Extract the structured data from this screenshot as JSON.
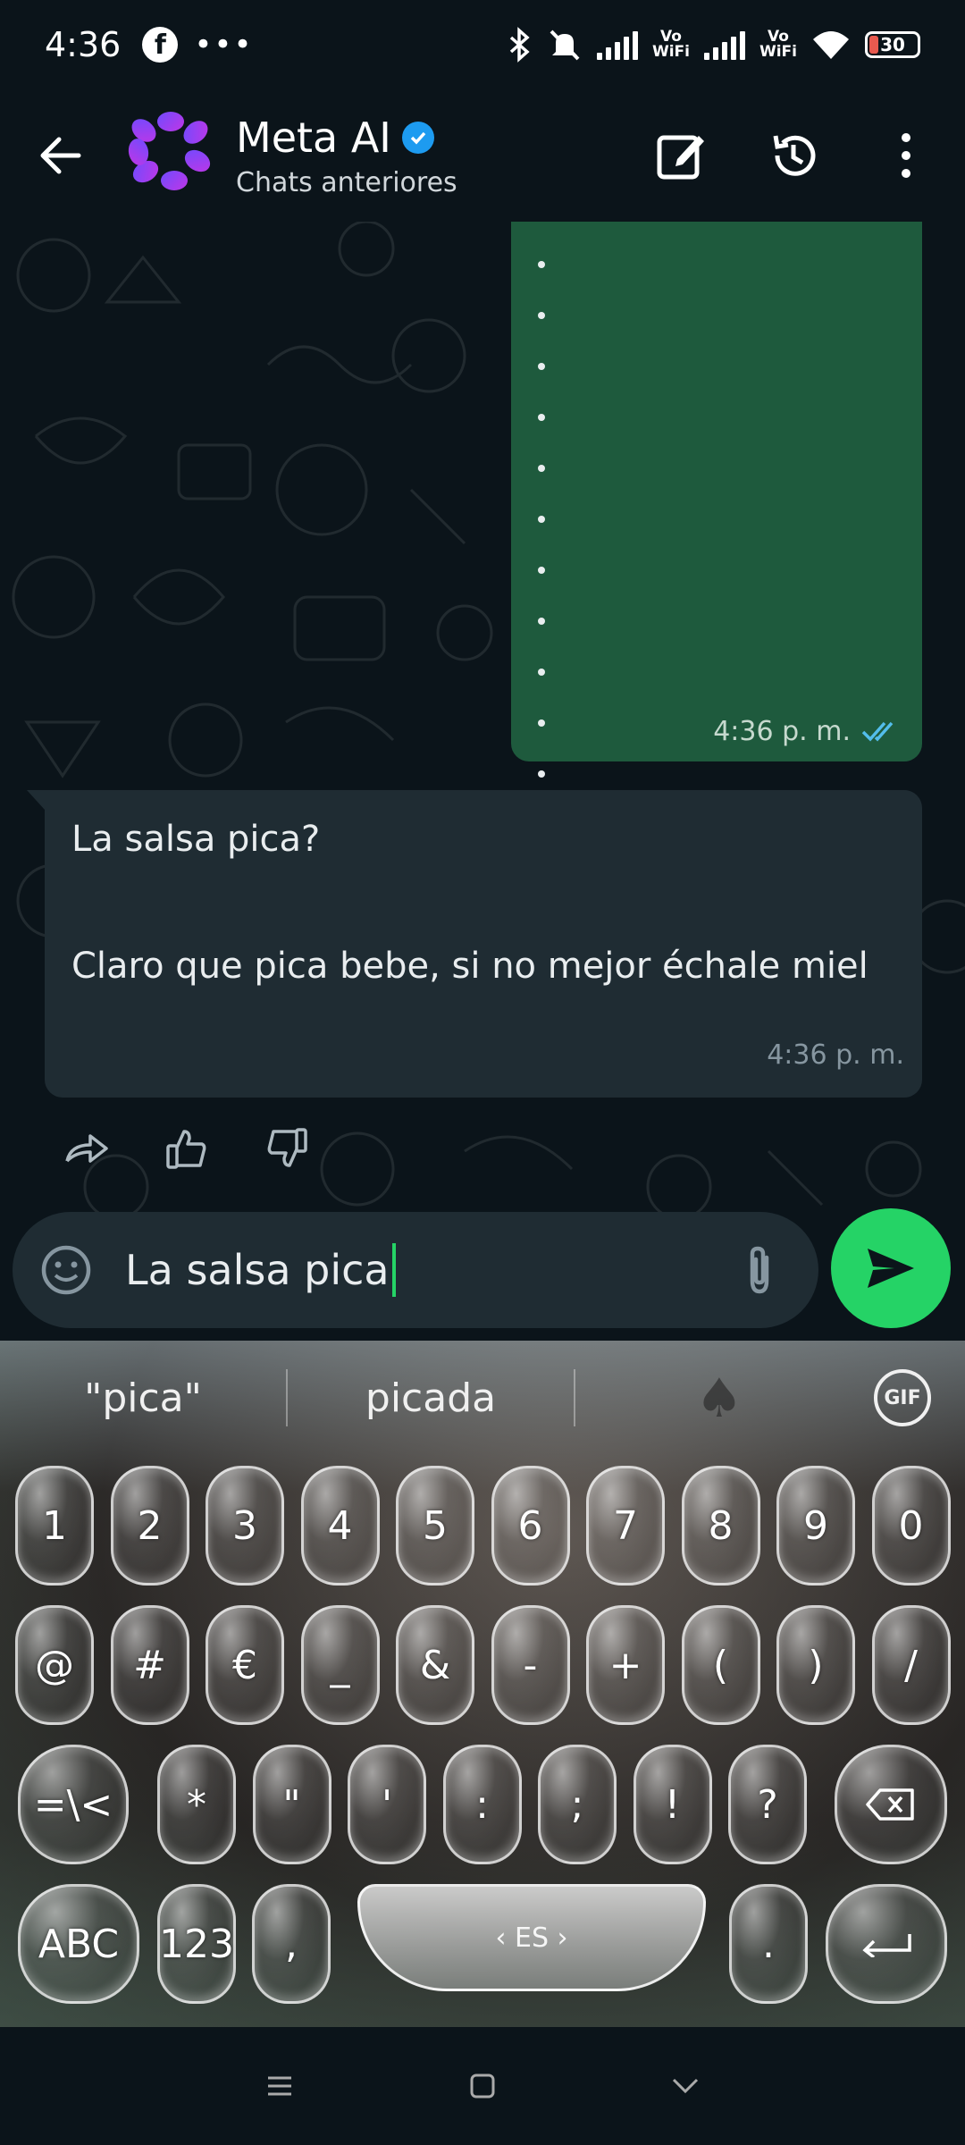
{
  "status_bar": {
    "time": "4:36",
    "more": "•••",
    "vowifi_1": "Vo\nWiFi",
    "vowifi_2": "Vo\nWiFi",
    "battery": "30"
  },
  "header": {
    "title": "Meta AI",
    "subtitle": "Chats anteriores"
  },
  "messages": {
    "outgoing": {
      "bullet_count": 11,
      "time": "4:36 p. m."
    },
    "incoming": {
      "line1": "La salsa pica?",
      "line2": "Claro que pica bebe, si no mejor échale miel",
      "time": "4:36 p. m."
    }
  },
  "composer": {
    "text": "La salsa pica"
  },
  "keyboard": {
    "suggestions": [
      "\"pica\"",
      "picada"
    ],
    "row1": [
      "1",
      "2",
      "3",
      "4",
      "5",
      "6",
      "7",
      "8",
      "9",
      "0"
    ],
    "row2": [
      "@",
      "#",
      "€",
      "_",
      "&",
      "-",
      "+",
      "(",
      ")",
      "/"
    ],
    "row3": [
      "=\\<",
      "*",
      "\"",
      "'",
      ":",
      ";",
      "!",
      "?"
    ],
    "row4": {
      "abc": "ABC",
      "num": "123",
      "comma": ",",
      "space": "ES",
      "period": "."
    }
  }
}
